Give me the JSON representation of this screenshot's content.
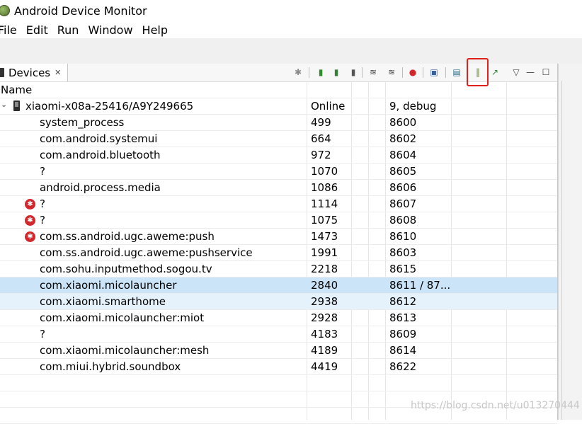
{
  "window": {
    "title": "Android Device Monitor"
  },
  "menu": [
    "File",
    "Edit",
    "Run",
    "Window",
    "Help"
  ],
  "view": {
    "tab_label": "Devices",
    "tab_close": "✕",
    "toolbar": [
      {
        "name": "debug-process-icon",
        "glyph": "✱",
        "color": "#8a8a8a"
      },
      {
        "name": "update-heap-icon",
        "glyph": "▮",
        "color": "#2e8b2e"
      },
      {
        "name": "dump-hprof-icon",
        "glyph": "▮",
        "color": "#3a7d3a"
      },
      {
        "name": "cause-gc-icon",
        "glyph": "▮",
        "color": "#555555"
      },
      {
        "name": "update-threads-icon",
        "glyph": "≋",
        "color": "#444444"
      },
      {
        "name": "start-method-profiling-icon",
        "glyph": "≋",
        "color": "#444444"
      },
      {
        "name": "stop-process-icon",
        "glyph": "●",
        "color": "#d3272b"
      },
      {
        "name": "screen-capture-icon",
        "glyph": "▣",
        "color": "#3a5fa0"
      },
      {
        "name": "dump-view-hierarchy-icon",
        "glyph": "▤",
        "color": "#2c6e8a"
      },
      {
        "name": "systrace-icon",
        "glyph": "‖",
        "color": "#6a8a3a"
      },
      {
        "name": "opengl-trace-icon",
        "glyph": "↗",
        "color": "#2e8b2e"
      },
      {
        "name": "view-menu-icon",
        "glyph": "▽",
        "color": "#444444"
      },
      {
        "name": "minimize-icon",
        "glyph": "—",
        "color": "#444444"
      },
      {
        "name": "maximize-icon",
        "glyph": "☐",
        "color": "#444444"
      }
    ]
  },
  "table": {
    "header": {
      "name": "Name"
    },
    "device": {
      "name": "xiaomi-x08a-25416/A9Y249665",
      "status": "Online",
      "info": "9, debug"
    },
    "rows": [
      {
        "name": "system_process",
        "pid": "499",
        "port": "8600",
        "bug": false
      },
      {
        "name": "com.android.systemui",
        "pid": "664",
        "port": "8602",
        "bug": false
      },
      {
        "name": "com.android.bluetooth",
        "pid": "972",
        "port": "8604",
        "bug": false
      },
      {
        "name": "?",
        "pid": "1070",
        "port": "8605",
        "bug": false
      },
      {
        "name": "android.process.media",
        "pid": "1086",
        "port": "8606",
        "bug": false
      },
      {
        "name": "?",
        "pid": "1114",
        "port": "8607",
        "bug": true
      },
      {
        "name": "?",
        "pid": "1075",
        "port": "8608",
        "bug": true
      },
      {
        "name": "com.ss.android.ugc.aweme:push",
        "pid": "1473",
        "port": "8610",
        "bug": true
      },
      {
        "name": "com.ss.android.ugc.aweme:pushservice",
        "pid": "1991",
        "port": "8603",
        "bug": false
      },
      {
        "name": "com.sohu.inputmethod.sogou.tv",
        "pid": "2218",
        "port": "8615",
        "bug": false
      },
      {
        "name": "com.xiaomi.micolauncher",
        "pid": "2840",
        "port": "8611 / 87...",
        "bug": false,
        "state": "selected"
      },
      {
        "name": "com.xiaomi.smarthome",
        "pid": "2938",
        "port": "8612",
        "bug": false,
        "state": "hover"
      },
      {
        "name": "com.xiaomi.micolauncher:miot",
        "pid": "2928",
        "port": "8613",
        "bug": false
      },
      {
        "name": "?",
        "pid": "4183",
        "port": "8609",
        "bug": false
      },
      {
        "name": "com.xiaomi.micolauncher:mesh",
        "pid": "4189",
        "port": "8614",
        "bug": false
      },
      {
        "name": "com.miui.hybrid.soundbox",
        "pid": "4419",
        "port": "8622",
        "bug": false
      }
    ]
  },
  "watermark": "https://blog.csdn.net/u013270444"
}
